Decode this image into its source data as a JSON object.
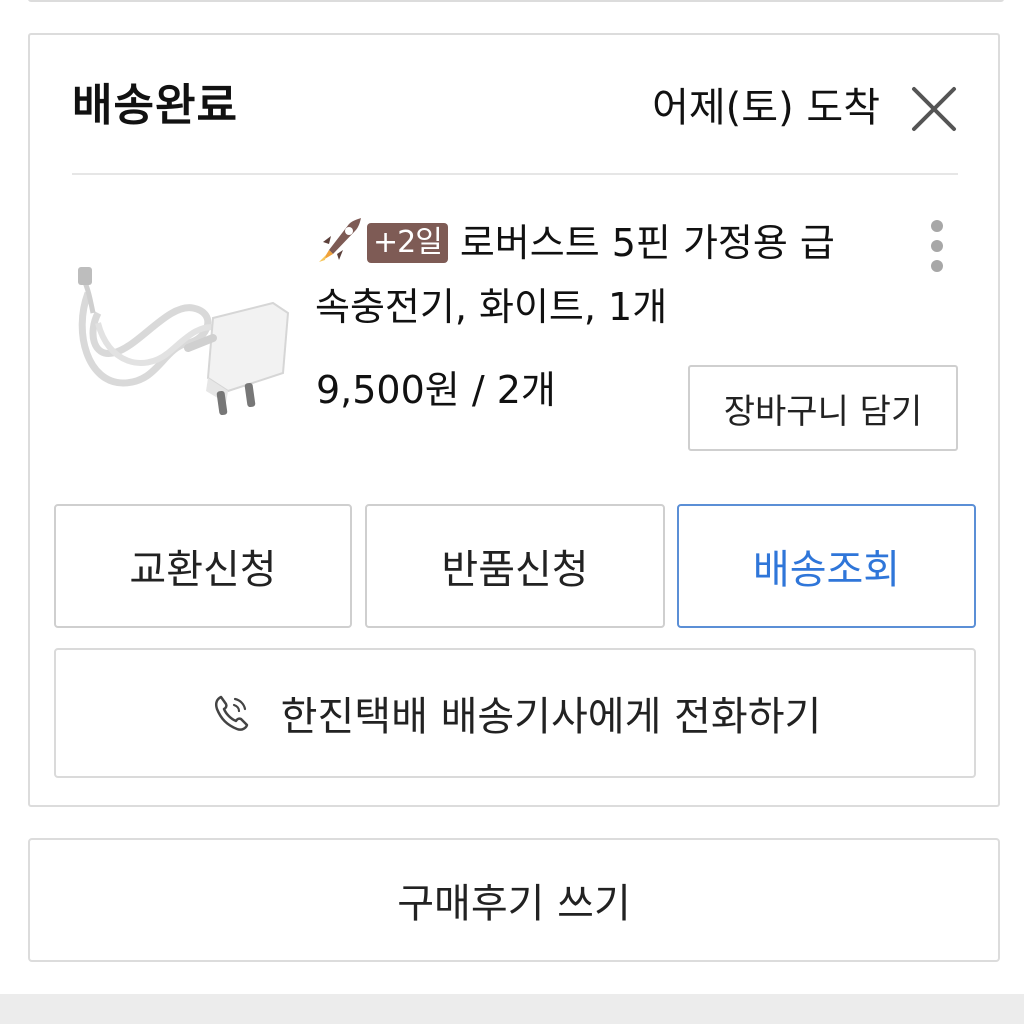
{
  "delivery": {
    "status": "배송완료",
    "arrival": "어제(토) 도착",
    "close_icon": "close-icon"
  },
  "product": {
    "image_icon": "charger-image",
    "rocket_icon": "rocket-icon",
    "badge": "+2일",
    "title_line1": "로버스트 5핀 가정용 급",
    "title_line2": "속충전기, 화이트, 1개",
    "price": "9,500원 / 2개",
    "more_icon": "more-vertical-icon"
  },
  "buttons": {
    "cart": "장바구니 담기",
    "exchange": "교환신청",
    "returns": "반품신청",
    "track": "배송조회",
    "call": "한진택배 배송기사에게 전화하기",
    "review": "구매후기 쓰기"
  },
  "colors": {
    "accent": "#2f76d9",
    "badge": "#7e5b55",
    "border": "#dcdcdc"
  }
}
